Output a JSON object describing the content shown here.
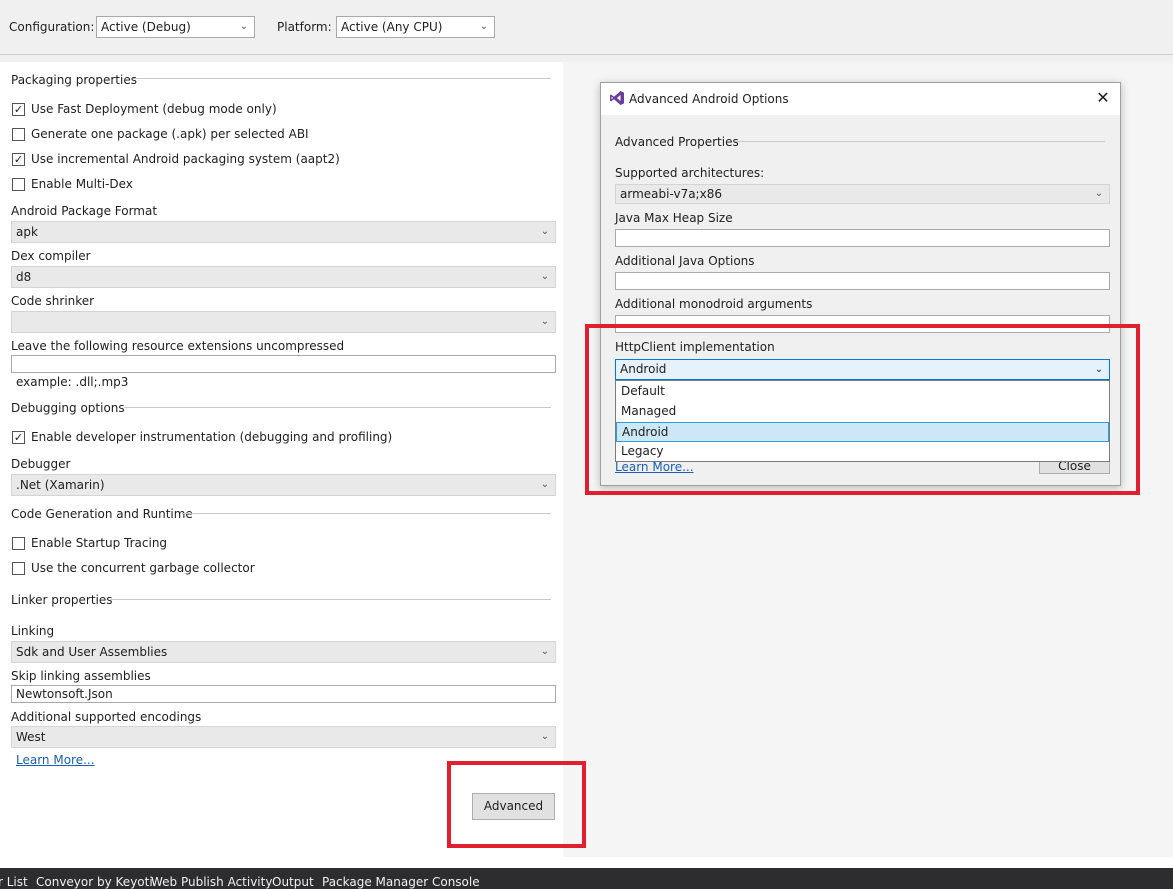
{
  "top": {
    "configuration_label": "Configuration:",
    "configuration_value": "Active (Debug)",
    "platform_label": "Platform:",
    "platform_value": "Active (Any CPU)"
  },
  "packaging": {
    "heading": "Packaging properties",
    "fast_deployment": {
      "label": "Use Fast Deployment (debug mode only)",
      "checked": true
    },
    "one_package_per_abi": {
      "label": "Generate one package (.apk) per selected ABI",
      "checked": false
    },
    "incremental_packaging": {
      "label": "Use incremental Android packaging system (aapt2)",
      "checked": true
    },
    "multi_dex": {
      "label": "Enable Multi-Dex",
      "checked": false
    },
    "package_format_label": "Android Package Format",
    "package_format_value": "apk",
    "dex_compiler_label": "Dex compiler",
    "dex_compiler_value": "d8",
    "code_shrinker_label": "Code shrinker",
    "code_shrinker_value": "",
    "uncompressed_label": "Leave the following resource extensions uncompressed",
    "uncompressed_value": "",
    "uncompressed_example": "example: .dll;.mp3"
  },
  "debugging": {
    "heading": "Debugging options",
    "dev_instrumentation": {
      "label": "Enable developer instrumentation (debugging and profiling)",
      "checked": true
    },
    "debugger_label": "Debugger",
    "debugger_value": ".Net (Xamarin)"
  },
  "codegen": {
    "heading": "Code Generation and Runtime",
    "startup_tracing": {
      "label": "Enable Startup Tracing",
      "checked": false
    },
    "concurrent_gc": {
      "label": "Use the concurrent garbage collector",
      "checked": false
    }
  },
  "linker": {
    "heading": "Linker properties",
    "linking_label": "Linking",
    "linking_value": "Sdk and User Assemblies",
    "skip_label": "Skip linking assemblies",
    "skip_value": "Newtonsoft.Json",
    "encodings_label": "Additional supported encodings",
    "encodings_value": "West",
    "learn_more": "Learn More...",
    "advanced_button": "Advanced"
  },
  "dialog": {
    "title": "Advanced Android Options",
    "close_glyph": "✕",
    "section_heading": "Advanced Properties",
    "architectures_label": "Supported architectures:",
    "architectures_value": "armeabi-v7a;x86",
    "heap_label": "Java Max Heap Size",
    "heap_value": "",
    "java_options_label": "Additional Java Options",
    "java_options_value": "",
    "monodroid_label": "Additional monodroid arguments",
    "monodroid_value": "",
    "httpclient_label": "HttpClient implementation",
    "httpclient_value": "Android",
    "httpclient_options": [
      "Default",
      "Managed",
      "Android",
      "Legacy"
    ],
    "httpclient_selected": "Android",
    "learn_more": "Learn More...",
    "close_button": "Close"
  },
  "statusbar": {
    "tabs": [
      "r List",
      "Conveyor by Keyoti",
      "Web Publish Activity",
      "Output",
      "Package Manager Console"
    ]
  },
  "icons": {
    "dropdown": "chevron-down-icon",
    "checkbox": "check-icon",
    "app": "visual-studio-icon",
    "close": "close-icon"
  },
  "colors": {
    "highlight_box": "#e0202e",
    "link": "#1a5fb4",
    "selection_bg": "#cce8f6",
    "selection_border": "#26a0da",
    "vs_purple": "#6a3d9a"
  }
}
